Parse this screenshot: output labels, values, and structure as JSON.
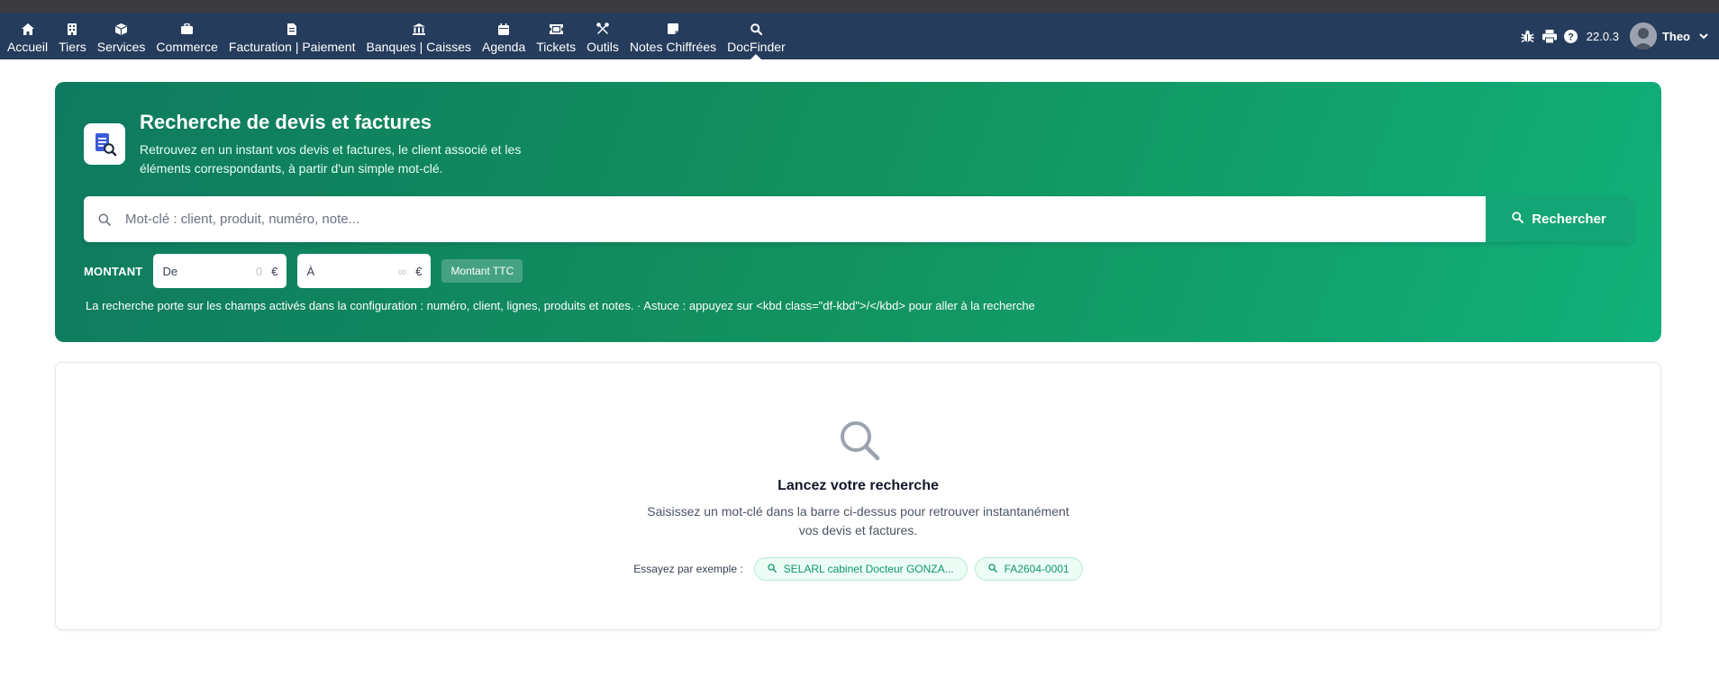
{
  "nav": {
    "items": [
      {
        "label": "Accueil",
        "icon": "home-icon"
      },
      {
        "label": "Tiers",
        "icon": "building-icon"
      },
      {
        "label": "Services",
        "icon": "cube-icon"
      },
      {
        "label": "Commerce",
        "icon": "briefcase-icon"
      },
      {
        "label": "Facturation | Paiement",
        "icon": "invoice-icon"
      },
      {
        "label": "Banques | Caisses",
        "icon": "bank-icon"
      },
      {
        "label": "Agenda",
        "icon": "calendar-icon"
      },
      {
        "label": "Tickets",
        "icon": "ticket-icon"
      },
      {
        "label": "Outils",
        "icon": "tools-icon"
      },
      {
        "label": "Notes Chiffrées",
        "icon": "note-icon"
      },
      {
        "label": "DocFinder",
        "icon": "search-icon"
      }
    ],
    "active": "DocFinder",
    "version": "22.0.3",
    "user": "Theo"
  },
  "hero": {
    "title": "Recherche de devis et factures",
    "subtitle": "Retrouvez en un instant vos devis et factures, le client associé et les éléments correspondants, à partir d'un simple mot-clé.",
    "search_placeholder": "Mot-clé : client, produit, numéro, note...",
    "search_button": "Rechercher",
    "amount_label": "MONTANT",
    "from_label": "De",
    "from_placeholder": "0",
    "to_label": "À",
    "to_placeholder": "∞",
    "currency": "€",
    "ttc_button": "Montant TTC",
    "hint": "La recherche porte sur les champs activés dans la configuration : numéro, client, lignes, produits et notes. · Astuce : appuyez sur <kbd class=\"df-kbd\">/</kbd> pour aller à la recherche"
  },
  "empty": {
    "title": "Lancez votre recherche",
    "text": "Saisissez un mot-clé dans la barre ci-dessus pour retrouver instantanément vos devis et factures.",
    "examples_label": "Essayez par exemple :",
    "examples": [
      "SELARL cabinet Docteur GONZA...",
      "FA2604-0001"
    ]
  },
  "colors": {
    "navbar": "#263c5c",
    "hero_start": "#0f7a5f",
    "hero_end": "#11b07a",
    "accent": "#13a576"
  }
}
